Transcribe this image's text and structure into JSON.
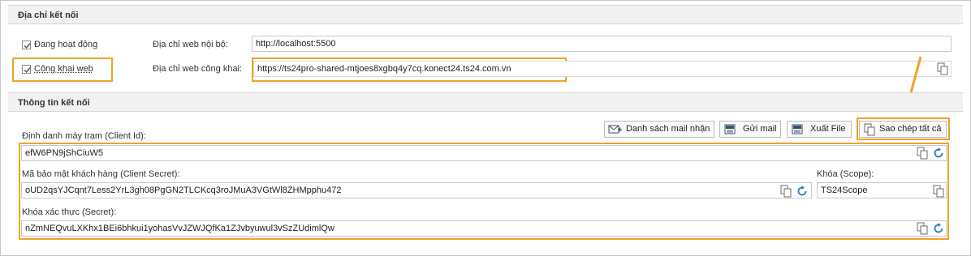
{
  "section1": {
    "title": "Địa chỉ kết nối",
    "active_label": "Đang hoạt động",
    "local_url_label": "Địa chỉ web nội bộ:",
    "local_url_value": "http://localhost:5500",
    "public_web_label": "Công khai web",
    "public_url_label": "Địa chỉ web công khai:",
    "public_url_value": "https://ts24pro-shared-mtjoes8xgbq4y7cq.konect24.ts24.com.vn"
  },
  "section2": {
    "title": "Thông tin kết nối",
    "client_id_label": "Định danh máy trạm (Client Id):",
    "client_id_value": "efW6PN9jShCiuW5",
    "client_secret_label": "Mã bảo mật khách hàng (Client Secret):",
    "client_secret_value": "oUD2qsYJCqnt7Less2YrL3gh08PgGN2TLCKcq3roJMuA3VGtWl8ZHMpphu472",
    "scope_label": "Khóa (Scope):",
    "scope_value": "TS24Scope",
    "secret_label": "Khóa xác thực (Secret):",
    "secret_value": "nZmNEQvuLXKhx1BEi6bhkui1yohasVvJZWJQfKa1ZJvbyuwul3vSzZUdimlQw"
  },
  "toolbar": {
    "mail_list_label": "Danh sách mail nhận",
    "send_mail_label": "Gửi mail",
    "export_file_label": "Xuất File",
    "copy_all_label": "Sao chép tất cả"
  },
  "colors": {
    "highlight": "#f0a22a",
    "refresh_icon": "#2a78c8"
  }
}
